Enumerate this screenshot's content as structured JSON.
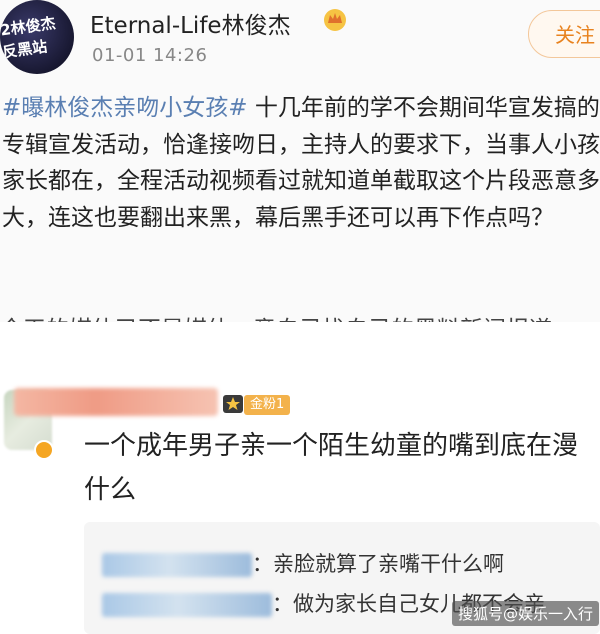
{
  "post": {
    "author": {
      "avatar_line1": "2林俊杰",
      "avatar_line2": "反黑站",
      "name": "Eternal-Life林俊杰",
      "crown_icon": "crown-icon"
    },
    "time": "01-01 14:26",
    "follow_label": "关注",
    "hashtag": "#曝林俊杰亲吻小女孩#",
    "body": "十几年前的学不会期间华宣发搞的专辑宣发活动，恰逢接吻日，主持人的要求下，当事人小孩家长都在，全程活动视频看过就知道单截取这个片段恶意多大，连这也要翻出来黑，幕后黑手还可以再下作点吗？",
    "cut_line": "今天的媒体已不是媒体，竟自己找自己的黑料新闻报道"
  },
  "comment": {
    "badge_label": "金粉1",
    "text": "一个成年男子亲一个陌生幼童的嘴到底在漫什么",
    "replies": [
      {
        "text": "：亲脸就算了亲嘴干什么啊"
      },
      {
        "text": "：做为家长自己女儿都不会亲"
      }
    ]
  },
  "watermark": "搜狐号@娱乐一入行",
  "colors": {
    "hashtag": "#5a7fb2",
    "follow": "#e8821e",
    "badge": "#f3b24b"
  }
}
